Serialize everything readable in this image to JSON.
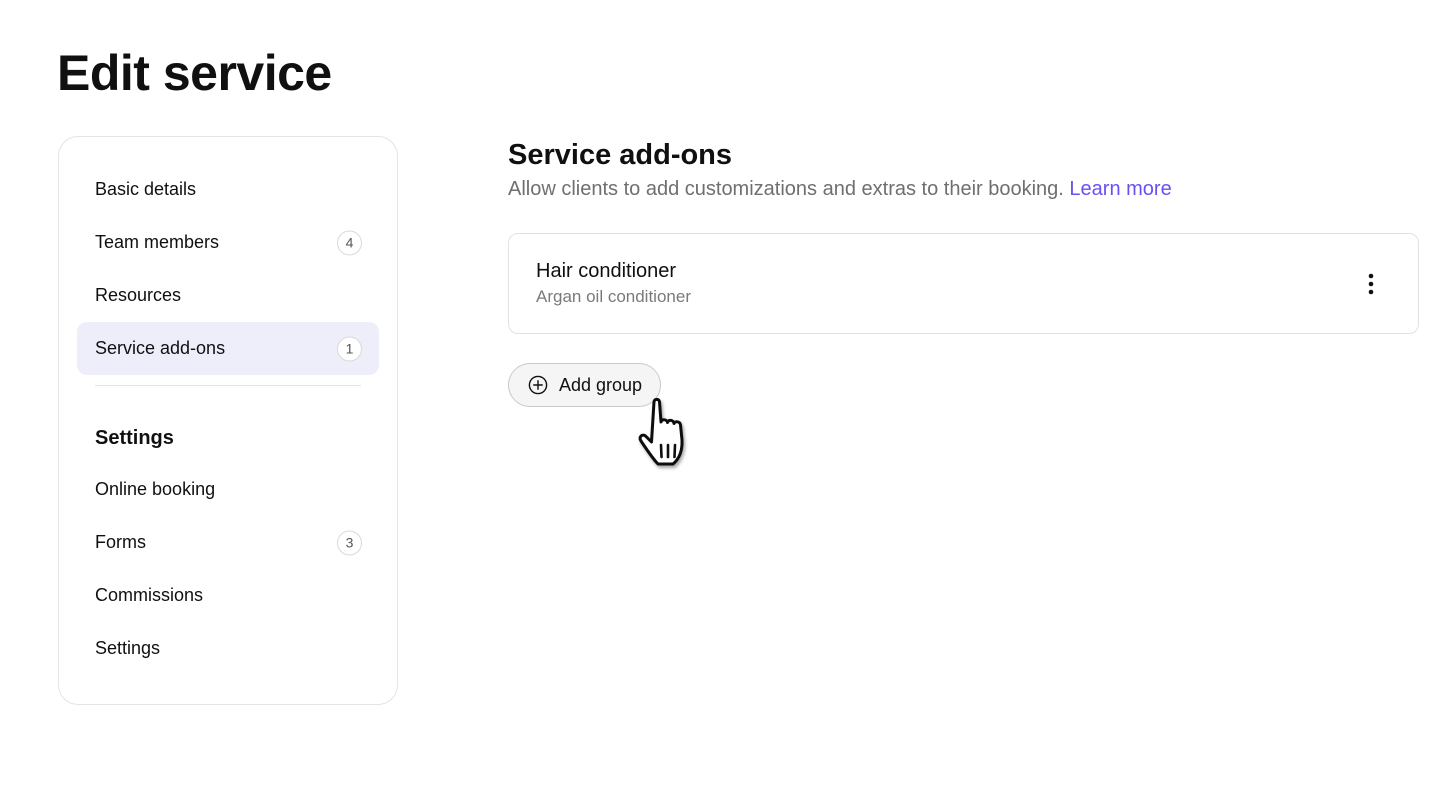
{
  "page": {
    "title": "Edit service"
  },
  "sidebar": {
    "items": [
      {
        "label": "Basic details"
      },
      {
        "label": "Team members",
        "count": "4"
      },
      {
        "label": "Resources"
      },
      {
        "label": "Service add-ons",
        "count": "1",
        "active": true
      }
    ],
    "settings_heading": "Settings",
    "settings_items": [
      {
        "label": "Online booking"
      },
      {
        "label": "Forms",
        "count": "3"
      },
      {
        "label": "Commissions"
      },
      {
        "label": "Settings"
      }
    ]
  },
  "main": {
    "title": "Service add-ons",
    "subtitle": "Allow clients to add customizations and extras to their booking.",
    "learn_more": "Learn more",
    "addon": {
      "name": "Hair conditioner",
      "description": "Argan oil conditioner",
      "more_icon": "more-vertical-icon"
    },
    "add_group_label": "Add group",
    "add_group_icon": "plus-circle-icon"
  },
  "colors": {
    "accent": "#6950f3",
    "active_bg": "#eeeefb"
  }
}
